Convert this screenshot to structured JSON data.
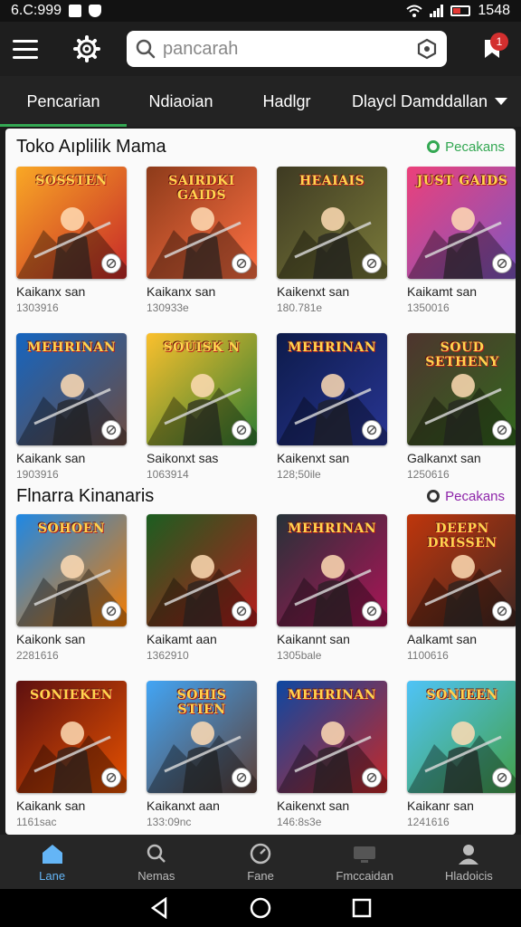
{
  "status_bar": {
    "time": "6.C:999",
    "battery": "1548"
  },
  "header": {
    "search": {
      "placeholder": "pancarah"
    },
    "notification_badge": "1"
  },
  "tabs": [
    {
      "label": "Pencarian",
      "active": true
    },
    {
      "label": "Ndiaoian",
      "active": false
    },
    {
      "label": "Hadlgr",
      "active": false
    },
    {
      "label": "Dlaycl Damddallan",
      "active": false
    }
  ],
  "sections": [
    {
      "title": "Toko Aıplilik Mama",
      "see_more": "Pecakans",
      "see_more_color": "#34a853",
      "items": [
        {
          "logo": "SOSSTEN",
          "title": "Kaikanx san",
          "sub": "1303916",
          "theme": [
            "#f9a825",
            "#c62828"
          ]
        },
        {
          "logo": "SAIRDKI GAIDS",
          "title": "Kaikanx san",
          "sub": "130933e",
          "theme": [
            "#8d3b1a",
            "#ff7043"
          ]
        },
        {
          "logo": "HEAIAIS",
          "title": "Kaikenxt san",
          "sub": "180.781e",
          "theme": [
            "#3e3a22",
            "#7a7a3a"
          ]
        },
        {
          "logo": "JUST GAIDS",
          "title": "Kaikamt san",
          "sub": "1350016",
          "theme": [
            "#ec407a",
            "#7e57c2"
          ]
        }
      ]
    },
    {
      "items": [
        {
          "logo": "MEHRINAN",
          "title": "Kaikank san",
          "sub": "1903916",
          "theme": [
            "#1565c0",
            "#6d4c41"
          ]
        },
        {
          "logo": "SOUISK N",
          "title": "Saikonxt sas",
          "sub": "1063914",
          "theme": [
            "#fbc02d",
            "#2e7d32"
          ]
        },
        {
          "logo": "MEHRINAN",
          "title": "Kaikenxt san",
          "sub": "128;50ile",
          "theme": [
            "#0d1b4a",
            "#283593"
          ]
        },
        {
          "logo": "SOUD SETHENY",
          "title": "Galkanxt san",
          "sub": "1250616",
          "theme": [
            "#4e342e",
            "#33691e"
          ]
        }
      ]
    },
    {
      "title": "Flnarra Kinanaris",
      "see_more": "Pecakans",
      "see_more_color": "#8e24aa",
      "items": [
        {
          "logo": "SOHOEN",
          "title": "Kaikonk san",
          "sub": "2281616",
          "theme": [
            "#1e88e5",
            "#f57c00"
          ]
        },
        {
          "logo": "",
          "title": "Kaikamt aan",
          "sub": "1362910",
          "theme": [
            "#1b5e20",
            "#b71c1c"
          ]
        },
        {
          "logo": "MEHRINAN",
          "title": "Kaikannt san",
          "sub": "1305bale",
          "theme": [
            "#263238",
            "#ad1457"
          ]
        },
        {
          "logo": "DEEPN DRISSEN",
          "title": "Aalkamt san",
          "sub": "1100616",
          "theme": [
            "#bf360c",
            "#3e2723"
          ]
        }
      ]
    },
    {
      "items": [
        {
          "logo": "SONIEKEN",
          "title": "Kaikank san",
          "sub": "1161sac",
          "theme": [
            "#5d1010",
            "#e65100"
          ]
        },
        {
          "logo": "SOHIS STIEN",
          "title": "Kaikanxt aan",
          "sub": "133:09nc",
          "theme": [
            "#42a5f5",
            "#5d4037"
          ]
        },
        {
          "logo": "MEHRINAN",
          "title": "Kaikenxt san",
          "sub": "146:8s3e",
          "theme": [
            "#0d47a1",
            "#c62828"
          ]
        },
        {
          "logo": "SONIEEN",
          "title": "Kaikanr san",
          "sub": "1241616",
          "theme": [
            "#4fc3f7",
            "#43a047"
          ]
        }
      ]
    }
  ],
  "bottom_nav": [
    {
      "label": "Lane",
      "icon": "home-icon",
      "active": true
    },
    {
      "label": "Nemas",
      "icon": "search-icon",
      "active": false
    },
    {
      "label": "Fane",
      "icon": "gauge-icon",
      "active": false
    },
    {
      "label": "Fmccaidan",
      "icon": "library-icon",
      "active": false
    },
    {
      "label": "Hladoicis",
      "icon": "profile-icon",
      "active": false
    }
  ],
  "colors": {
    "accent": "#34a853",
    "active_nav": "#64b5f6"
  }
}
